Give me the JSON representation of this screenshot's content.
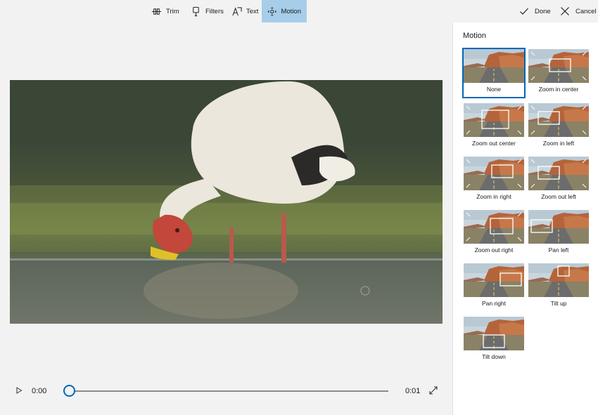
{
  "toolbar": {
    "tools": [
      {
        "label": "Trim",
        "icon": "trim-icon",
        "active": false
      },
      {
        "label": "Filters",
        "icon": "filters-icon",
        "active": false
      },
      {
        "label": "Text",
        "icon": "text-icon",
        "active": false
      },
      {
        "label": "Motion",
        "icon": "motion-icon",
        "active": true
      }
    ],
    "done_label": "Done",
    "cancel_label": "Cancel"
  },
  "player": {
    "current_time": "0:00",
    "end_time": "0:01",
    "progress": 0
  },
  "motion_panel": {
    "title": "Motion",
    "selected": "None",
    "effects": [
      "None",
      "Zoom in center",
      "Zoom out center",
      "Zoom in left",
      "Zoom in right",
      "Zoom out left",
      "Zoom out right",
      "Pan left",
      "Pan right",
      "Tilt up",
      "Tilt down"
    ]
  },
  "colors": {
    "accent": "#0067b8",
    "active_tool_bg": "#a6cde9",
    "panel_bg": "#ffffff",
    "app_bg": "#f2f2f2"
  }
}
